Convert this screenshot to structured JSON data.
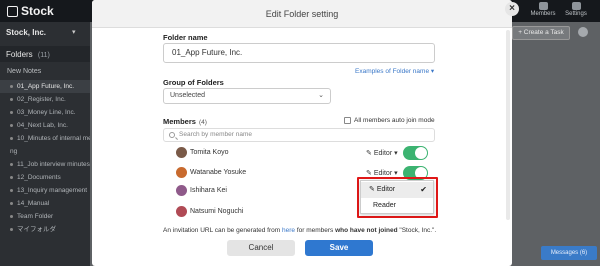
{
  "app": {
    "logo_text": "Stock",
    "company": "Stock, Inc.",
    "top_icons": [
      {
        "label": "Members",
        "icon": "members-icon"
      },
      {
        "label": "Settings",
        "icon": "settings-icon"
      }
    ]
  },
  "sidebar": {
    "folders_label": "Folders",
    "folders_count": "(11)",
    "new_notes": "New Notes",
    "folders": [
      "01_App Future, Inc.",
      "02_Register, Inc.",
      "03_Money Line, Inc.",
      "04_Next Lab, Inc.",
      "10_Minutes of internal mee",
      "ng",
      "11_Job interview minutes",
      "12_Documents",
      "13_Inquiry management",
      "14_Manual",
      "Team Folder",
      "マイフォルダ"
    ],
    "selected_index": 0
  },
  "main": {
    "create_task": "+ Create a Task",
    "messages": "Messages (6)"
  },
  "modal": {
    "title": "Edit Folder setting",
    "folder_name_label": "Folder name",
    "folder_name_value": "01_App Future, Inc.",
    "examples_link": "Examples of Folder name ▾",
    "group_label": "Group of Folders",
    "group_value": "Unselected",
    "members_label": "Members",
    "members_count": "(4)",
    "auto_join_label": "All members auto join mode",
    "search_placeholder": "Search by member name",
    "members": [
      {
        "name": "Tomita Koyo",
        "role": "Editor",
        "enabled": true,
        "avatar_color": "#7a5a48"
      },
      {
        "name": "Watanabe Yosuke",
        "role": "Editor",
        "enabled": true,
        "avatar_color": "#c86a2e"
      },
      {
        "name": "Ishihara Kei",
        "role": "",
        "enabled": true,
        "avatar_color": "#8f5a8a"
      },
      {
        "name": "Natsumi Noguchi",
        "role": "",
        "enabled": true,
        "avatar_color": "#b04a55"
      }
    ],
    "role_menu": {
      "options": [
        "Editor",
        "Reader"
      ],
      "selected": "Editor"
    },
    "invite_note": {
      "prefix": "An invitation URL can be generated from ",
      "link": "here",
      "middle": " for members ",
      "bold": "who have not joined",
      "suffix": " \"Stock, Inc.\"."
    },
    "cancel_label": "Cancel",
    "save_label": "Save"
  },
  "colors": {
    "toggle_on": "#3cb371",
    "primary": "#2f78d0",
    "highlight_box": "#e01818"
  }
}
